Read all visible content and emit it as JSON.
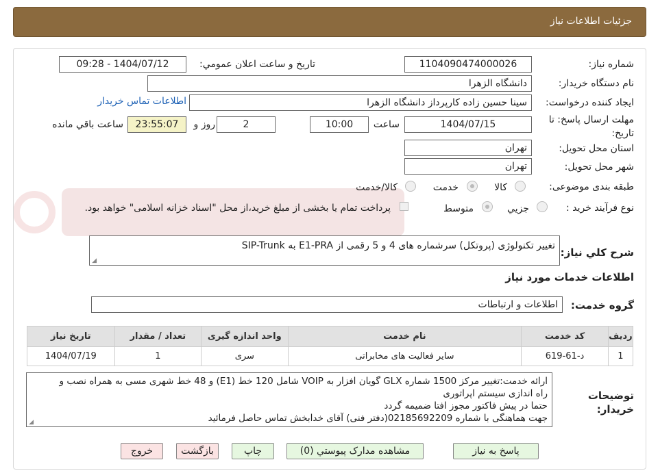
{
  "header": {
    "title": "جزئیات اطلاعات نیاز"
  },
  "form": {
    "need_number_label": "شماره نیاز:",
    "need_number": "1104090474000026",
    "announce_label": "تاریخ و ساعت اعلان عمومي:",
    "announce_value": "1404/07/12 - 09:28",
    "buyer_org_label": "نام دستگاه خریدار:",
    "buyer_org": "دانشگاه الزهرا",
    "requester_label": "ایجاد کننده درخواست:",
    "requester": "سینا حسین زاده کارپرداز دانشگاه الزهرا",
    "contact_link": "اطلاعات تماس خریدار",
    "deadline_label": "مهلت ارسال پاسخ: تا تاریخ:",
    "deadline_date": "1404/07/15",
    "time_label": "ساعت",
    "deadline_time": "10:00",
    "days_value": "2",
    "days_label": "روز و",
    "remaining_time": "23:55:07",
    "remaining_label": "ساعت باقي مانده",
    "province_label": "استان محل تحویل:",
    "province": "تهران",
    "city_label": "شهر محل تحویل:",
    "city": "تهران",
    "category_label": "طبقه بندی موضوعی:",
    "category_options": [
      "کالا",
      "خدمت",
      "کالا/خدمت"
    ],
    "process_label": "نوع فرآیند خرید :",
    "process_options": [
      "جزیي",
      "متوسط"
    ],
    "payment_note": "پرداخت تمام یا بخشی از مبلغ خرید،از محل \"اسناد خزانه اسلامی\" خواهد بود."
  },
  "summary": {
    "label": "شرح کلي نیاز:",
    "text": "تغییر تکنولوژی (پروتکل) سرشماره های 4 و 5 رقمی از E1-PRA  به SIP-Trunk"
  },
  "services": {
    "section_title": "اطلاعات خدمات مورد نیاز",
    "group_label": "گروه خدمت:",
    "group_value": "اطلاعات و ارتباطات",
    "columns": [
      "ردیف",
      "کد خدمت",
      "نام خدمت",
      "واحد اندازه گیری",
      "تعداد / مقدار",
      "تاریخ نیاز"
    ],
    "rows": [
      [
        "1",
        "د-61-619",
        "سایر فعالیت های مخابراتی",
        "سری",
        "1",
        "1404/07/19"
      ]
    ]
  },
  "buyer_notes": {
    "label": "توضیحات خریدار:",
    "lines": [
      "ارائه خدمت:تغییر مرکز 1500 شماره GLX گویان افزار به VOIP شامل 120 خط (E1) و 48 خط شهری مسی به همراه نصب و",
      "راه اندازی سیستم اپراتوری",
      "حتما در پیش فاکتور مجوز افتا ضمیمه گردد",
      "جهت هماهنگی با شماره 02185692209(دفتر فنی) آقای خدابخش تماس حاصل فرمائید"
    ]
  },
  "buttons": {
    "reply": "پاسخ به نیاز",
    "attachments": "مشاهده مدارک پیوستي (0)",
    "print": "چاپ",
    "back": "بازگشت",
    "exit": "خروج"
  }
}
